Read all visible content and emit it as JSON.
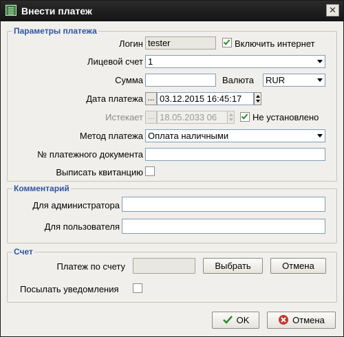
{
  "window": {
    "title": "Внести платеж",
    "close_glyph": "✕"
  },
  "payment_params": {
    "legend": "Параметры платежа",
    "login_label": "Логин",
    "login_value": "tester",
    "enable_internet_label": "Включить интернет",
    "enable_internet_checked": true,
    "account_label": "Лицевой счет",
    "account_value": "1",
    "sum_label": "Сумма",
    "sum_value": "",
    "currency_label": "Валюта",
    "currency_value": "RUR",
    "date_label": "Дата платежа",
    "date_value": "03.12.2015 16:45:17",
    "date_button": "...",
    "expires_label": "Истекает",
    "expires_value": "18.05.2033 06",
    "expires_button": "...",
    "not_set_label": "Не установлено",
    "not_set_checked": true,
    "method_label": "Метод платежа",
    "method_value": "Оплата наличными",
    "doc_number_label": "№ платежного документа",
    "doc_number_value": "",
    "receipt_label": "Выписать квитанцию",
    "receipt_checked": false
  },
  "comment": {
    "legend": "Комментарий",
    "admin_label": "Для администратора",
    "admin_value": "",
    "user_label": "Для пользователя",
    "user_value": ""
  },
  "invoice": {
    "legend": "Счет",
    "payment_by_invoice_label": "Платеж по счету",
    "payment_by_invoice_value": "",
    "choose_button": "Выбрать",
    "cancel_button": "Отмена",
    "notify_label": "Посылать уведомления",
    "notify_checked": false
  },
  "footer": {
    "ok_button": "OK",
    "cancel_button": "Отмена"
  },
  "icons": {
    "ok": "check-icon",
    "cancel": "cancel-circle-icon",
    "app": "app-list-icon"
  },
  "colors": {
    "legend": "#2d55a0",
    "check": "#2d8a2d",
    "cancel": "#c0392b"
  }
}
